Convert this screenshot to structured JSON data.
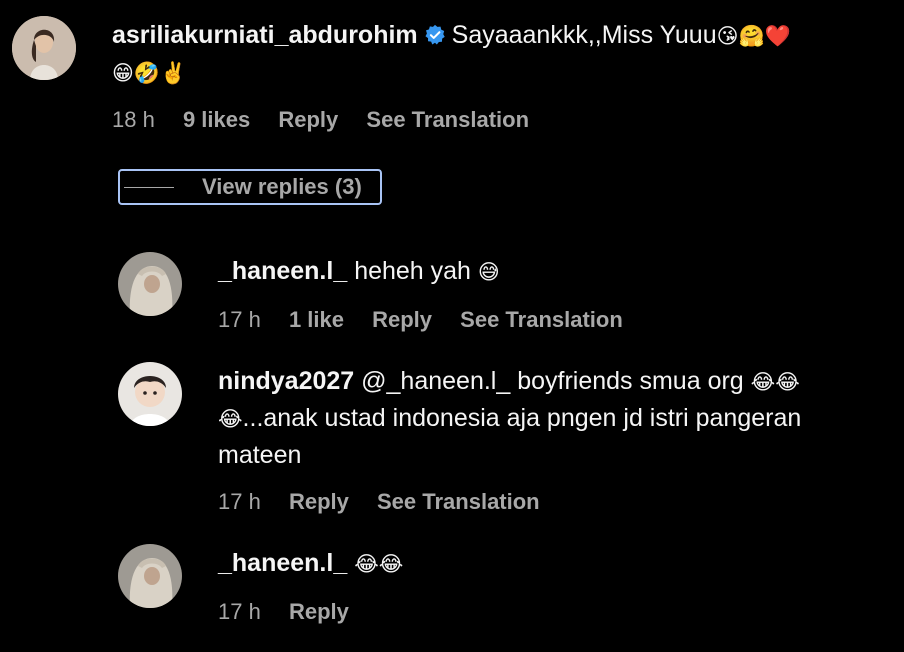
{
  "comments": [
    {
      "username": "asriliakurniati_abdurohim",
      "verified": true,
      "text_line1": "Sayaaankkk,,Miss Yuuu",
      "emoji_line1": "😘🤗❤️",
      "emoji_line2": "😁🤣✌️",
      "time": "18 h",
      "likes": "9 likes",
      "reply_label": "Reply",
      "translate_label": "See Translation",
      "avatar_icon": "woman-avatar"
    }
  ],
  "view_replies": {
    "label": "View replies (3)"
  },
  "replies": [
    {
      "username": "_haneen.l_",
      "text": "heheh yah",
      "emoji": "😅",
      "time": "17 h",
      "likes": "1 like",
      "reply_label": "Reply",
      "translate_label": "See Translation",
      "avatar_icon": "hijab-avatar"
    },
    {
      "username": "nindya2027",
      "text_line1": "@_haneen.l_ boyfriends smua org",
      "emoji_line1": "😂😂",
      "emoji_line2": "😂",
      "text_line2": "...anak ustad indonesia aja pngen jd istri pangeran",
      "text_line3": "mateen",
      "time": "17 h",
      "reply_label": "Reply",
      "translate_label": "See Translation",
      "avatar_icon": "child-avatar"
    },
    {
      "username": "_haneen.l_",
      "emoji": "😂😂",
      "time": "17 h",
      "reply_label": "Reply",
      "avatar_icon": "hijab-avatar"
    }
  ],
  "colors": {
    "background": "#000000",
    "text": "#f5f5f5",
    "meta": "#a8a8a8",
    "verified": "#3797f0",
    "focus_outline": "#a9c4f5"
  }
}
